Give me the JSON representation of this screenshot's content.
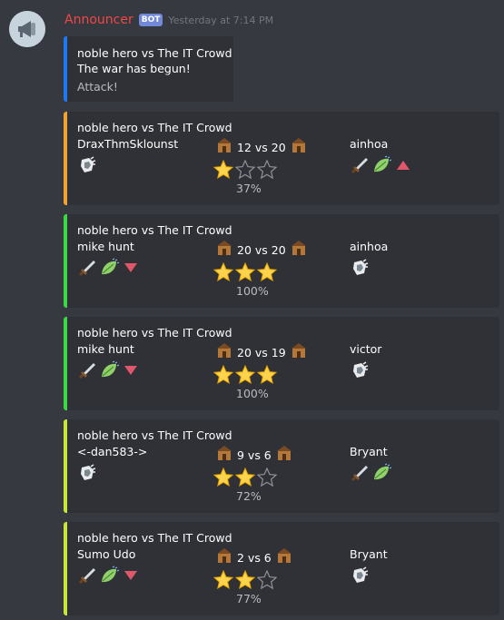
{
  "message": {
    "author": "Announcer",
    "bot_tag": "BOT",
    "timestamp": "Yesterday at 7:14 PM"
  },
  "first_embed": {
    "lines": [
      "noble hero vs The IT Crowd",
      "The war has begun!",
      "Attack!"
    ],
    "color": "#1d79f2"
  },
  "attacks": [
    {
      "title": "noble hero vs The IT Crowd",
      "attacker": "DraxThmSklounst",
      "defender": "ainhoa",
      "vs": "12 vs 20",
      "stars": 1,
      "percent": "37%",
      "color": "#f0a232",
      "left_icons": [
        "shield-icon"
      ],
      "right_icons": [
        "sword-icon",
        "leaf-icon",
        "arrow-up-icon"
      ]
    },
    {
      "title": "noble hero vs The IT Crowd",
      "attacker": "mike hunt",
      "defender": "ainhoa",
      "vs": "20 vs 20",
      "stars": 3,
      "percent": "100%",
      "color": "#3ad845",
      "left_icons": [
        "sword-icon",
        "leaf-icon",
        "arrow-down-icon"
      ],
      "right_icons": [
        "shield-icon"
      ]
    },
    {
      "title": "noble hero vs The IT Crowd",
      "attacker": "mike hunt",
      "defender": "victor",
      "vs": "20 vs 19",
      "stars": 3,
      "percent": "100%",
      "color": "#3ad845",
      "left_icons": [
        "sword-icon",
        "leaf-icon",
        "arrow-down-icon"
      ],
      "right_icons": [
        "shield-icon"
      ]
    },
    {
      "title": "noble hero vs The IT Crowd",
      "attacker": "<-dan583->",
      "defender": "Bryant",
      "vs": "9 vs 6",
      "stars": 2,
      "percent": "72%",
      "color": "#c8e63a",
      "left_icons": [
        "shield-icon"
      ],
      "right_icons": [
        "sword-icon",
        "leaf-icon"
      ]
    },
    {
      "title": "noble hero vs The IT Crowd",
      "attacker": "Sumo Udo",
      "defender": "Bryant",
      "vs": "2 vs 6",
      "stars": 2,
      "percent": "77%",
      "color": "#c8e63a",
      "left_icons": [
        "sword-icon",
        "leaf-icon",
        "arrow-down-icon"
      ],
      "right_icons": [
        "shield-icon"
      ]
    }
  ]
}
